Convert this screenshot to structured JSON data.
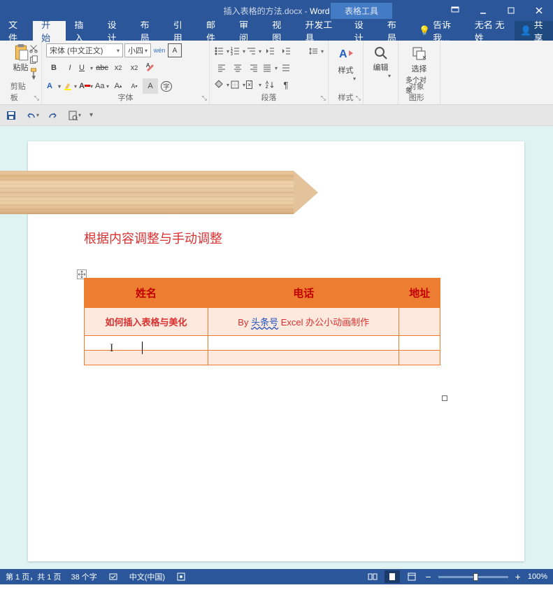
{
  "title": {
    "file": "插入表格的方法.docx",
    "app": "Word",
    "context_tab": "表格工具"
  },
  "menu": {
    "file": "文件",
    "home": "开始",
    "insert": "插入",
    "design": "设计",
    "layout": "布局",
    "ref": "引用",
    "mail": "邮件",
    "review": "审阅",
    "view": "视图",
    "dev": "开发工具",
    "tdesign": "设计",
    "tlayout": "布局",
    "tell_me": "告诉我...",
    "login": "无名 无姓",
    "share": "共享"
  },
  "ribbon": {
    "clipboard": {
      "label": "剪贴板",
      "paste": "粘贴"
    },
    "font": {
      "label": "字体",
      "name": "宋体 (中文正文)",
      "size": "小四",
      "wen": "wén"
    },
    "paragraph": {
      "label": "段落"
    },
    "styles": {
      "label": "样式",
      "btn": "样式"
    },
    "editing": {
      "label": "编辑",
      "btn": "编辑"
    },
    "select_obj": {
      "btn1": "选择",
      "btn2": "多个对象",
      "label": "对象图形"
    }
  },
  "document": {
    "heading": "根据内容调整与手动调整",
    "table": {
      "headers": [
        "姓名",
        "电话",
        "地址"
      ],
      "rows": [
        [
          "如何插入表格与美化",
          "By 头条号 Excel 办公小动画制作",
          ""
        ],
        [
          "",
          "",
          ""
        ],
        [
          "",
          "",
          ""
        ]
      ]
    }
  },
  "status": {
    "page": "第 1 页，共 1 页",
    "words": "38 个字",
    "lang": "中文(中国)",
    "zoom": "100%"
  }
}
